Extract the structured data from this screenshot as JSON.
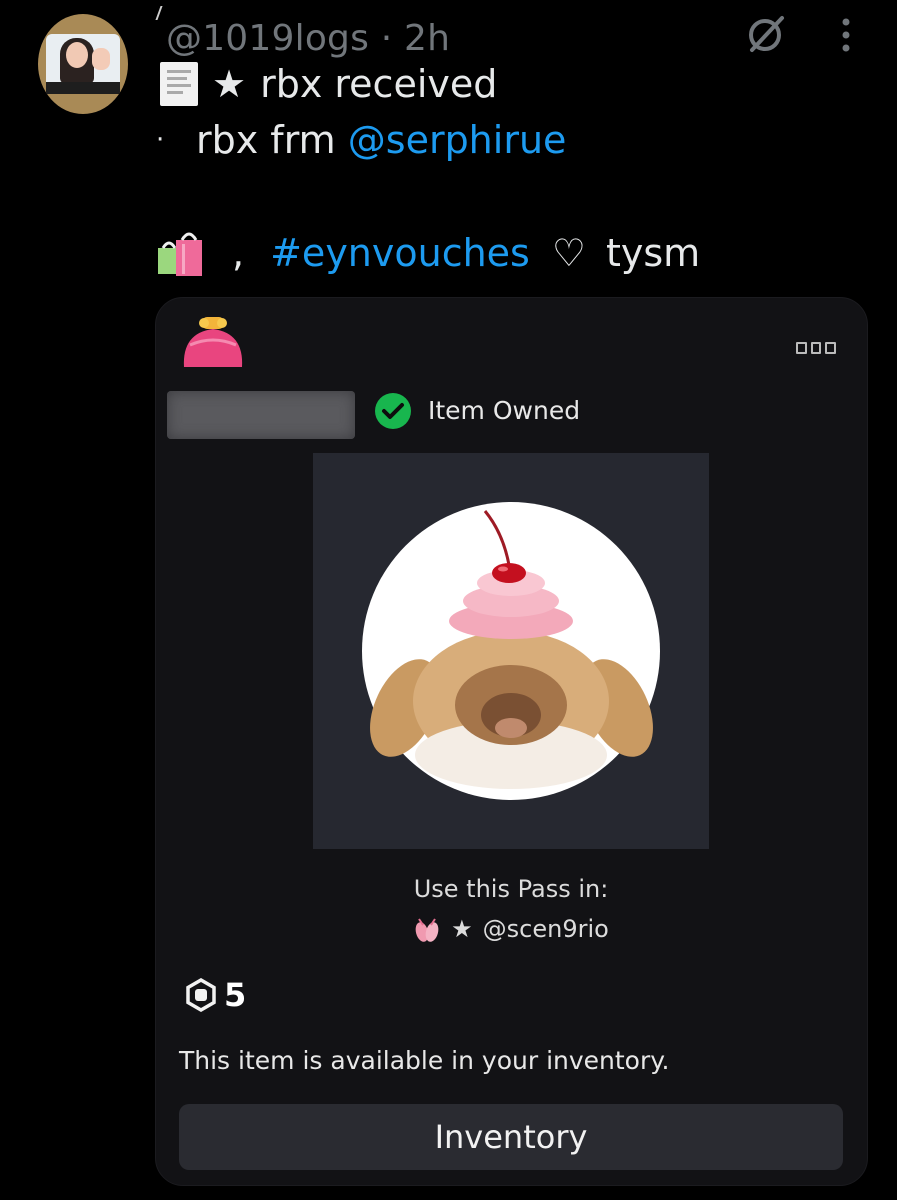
{
  "post": {
    "handle": "@1019logs",
    "separator": "·",
    "time": "2h",
    "line1_star": "★",
    "line1_text": "rbx received",
    "line2_bullet": "·",
    "line2_text": "rbx frm",
    "line2_mention": "@serphirue",
    "line3_comma": ",",
    "line3_hashtag": "#eynvouches",
    "line3_heart": "♡",
    "line3_text": "tysm"
  },
  "card": {
    "status_label": "Item Owned",
    "use_label": "Use this Pass in:",
    "place_star": "★",
    "place_name": "@scen9rio",
    "price": "5",
    "availability": "This item is available in your inventory.",
    "button_label": "Inventory"
  },
  "icons": {
    "header_right": [
      "no-show-icon",
      "more-vertical-icon"
    ],
    "emoji": [
      "receipt-icon",
      "shopping-bags-icon",
      "purse-icon",
      "ballet-shoes-icon"
    ],
    "card": [
      "more-options-icon",
      "check-circle-icon",
      "robux-icon"
    ]
  },
  "colors": {
    "background": "#000000",
    "text": "#e7e9ea",
    "muted": "#71767b",
    "link": "#1d9bf0",
    "card_bg": "#121215",
    "check_green": "#18b64e",
    "button_bg": "#2a2b31"
  }
}
